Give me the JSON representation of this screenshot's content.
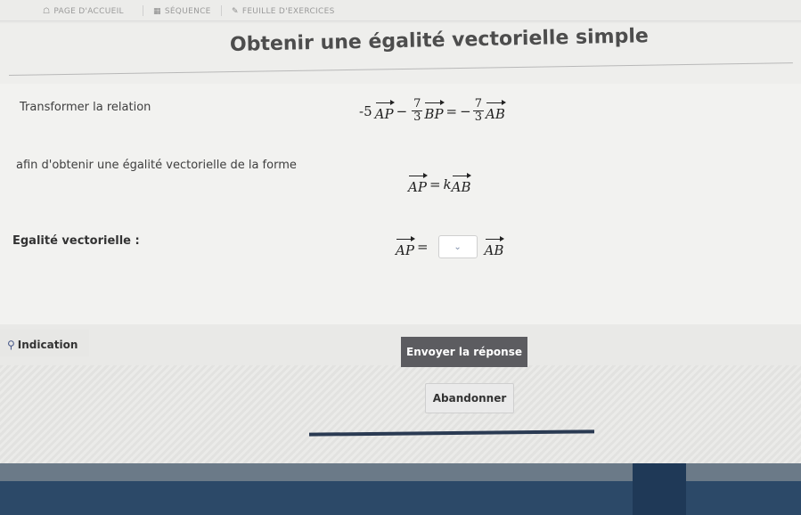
{
  "nav": {
    "home": "PAGE D'ACCUEIL",
    "sequence": "SÉQUENCE",
    "sheet": "FEUILLE D'EXERCICES"
  },
  "title": "Obtenir une égalité vectorielle simple",
  "prompt": {
    "transform": "Transformer la relation",
    "goal": "afin d'obtenir une égalité vectorielle de la forme",
    "answer_label": "Egalité vectorielle :"
  },
  "equation1": {
    "left_coeff": "-5",
    "v1": "AP",
    "minus": "−",
    "frac1_num": "7",
    "frac1_den": "3",
    "v2": "BP",
    "eq": "=",
    "neg": "−",
    "frac2_num": "7",
    "frac2_den": "3",
    "v3": "AB"
  },
  "equation2": {
    "v1": "AP",
    "eq": "=",
    "k": "k",
    "v2": "AB"
  },
  "answer": {
    "v1": "AP",
    "eq": "=",
    "v2": "AB",
    "selected": ""
  },
  "hint": "Indication",
  "buttons": {
    "submit": "Envoyer la réponse",
    "abandon": "Abandonner"
  },
  "icons": {
    "home": "home-icon",
    "sequence": "list-icon",
    "sheet": "edit-icon",
    "hint": "lightbulb-icon",
    "select": "chevron-down-icon"
  }
}
